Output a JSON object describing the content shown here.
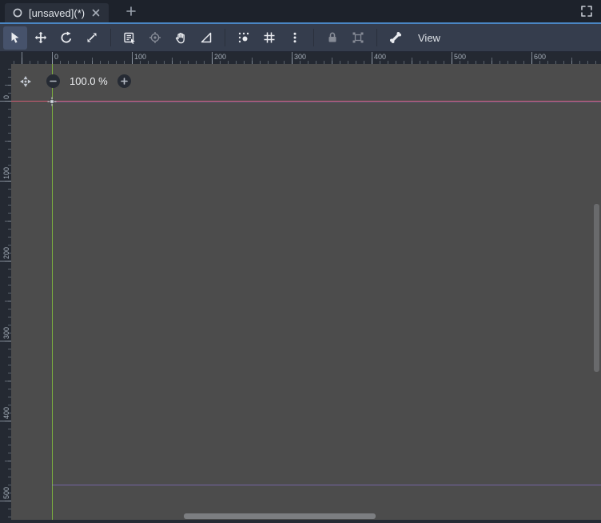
{
  "tabbar": {
    "scene_tab": {
      "label": "[unsaved](*)",
      "icon": "scene-circle-icon",
      "close_icon": "close-icon"
    },
    "add_tab_icon": "plus-icon",
    "expand_icon": "expand-window-icon"
  },
  "toolbar": {
    "view_label": "View",
    "tool_icons": [
      "select-mode-icon",
      "move-mode-icon",
      "rotate-mode-icon",
      "scale-mode-icon",
      "list-select-icon",
      "pivot-icon",
      "pan-mode-icon",
      "ruler-mode-icon",
      "smart-snap-icon",
      "grid-snap-icon",
      "snap-options-kebab-icon",
      "lock-icon",
      "group-icon",
      "skeleton-bone-icon"
    ],
    "active_tool": "select-mode",
    "disabled_tools": [
      "pivot",
      "lock",
      "group"
    ]
  },
  "zoom": {
    "value_label": "100.0 %",
    "icons": [
      "center-view-icon",
      "zoom-out-icon",
      "zoom-in-icon"
    ]
  },
  "rulers": {
    "top": [
      "0",
      "100",
      "200",
      "300",
      "400",
      "500",
      "600"
    ],
    "left": [
      "0",
      "100",
      "200",
      "300",
      "400",
      "500"
    ]
  },
  "colors": {
    "accent_blue": "#4a86c4",
    "tabbar_bg": "#1d222b",
    "toolbar_bg": "#353d4d",
    "ruler_bg": "#242932",
    "canvas_bg": "#4c4c4c",
    "axis_x_red": "#db5e78",
    "axis_y_green": "#82bc3e",
    "viewport_border_purple": "#9678eb"
  }
}
